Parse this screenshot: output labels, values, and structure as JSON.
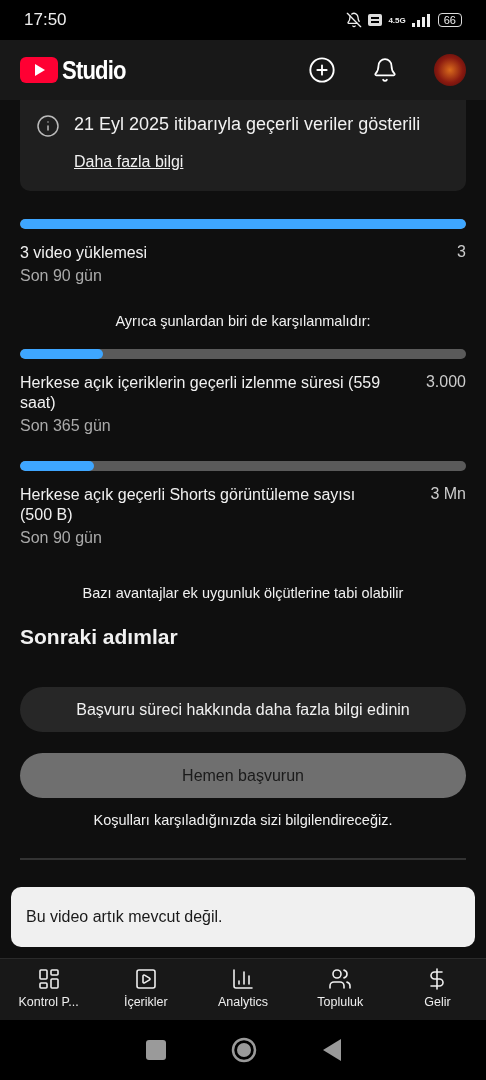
{
  "status_bar": {
    "time": "17:50",
    "network": "4.5G",
    "battery": "66"
  },
  "app_bar": {
    "logo_text": "Studio"
  },
  "info_card": {
    "message": "21 Eyl 2025 itibarıyla geçerli veriler gösterili",
    "link": "Daha fazla bilgi"
  },
  "requirements": [
    {
      "level": 1,
      "title": "3 video yüklemesi",
      "value": "3",
      "period": "Son 90 gün"
    }
  ],
  "also_note": "Ayrıca şunlardan biri de karşılanmalıdır:",
  "alternatives": [
    {
      "level": 0.186,
      "title": "Herkese açık içeriklerin geçerli izlenme süresi (559 saat)",
      "value": "3.000",
      "period": "Son 365 gün"
    },
    {
      "level": 0.167,
      "title": "Herkese açık geçerli Shorts görüntüleme sayısı (500 B)",
      "value": "3 Mn",
      "period": "Son 90 gün"
    }
  ],
  "eligibility_note": "Bazı avantajlar ek uygunluk ölçütlerine tabi olabilir",
  "next_steps": {
    "heading": "Sonraki adımlar",
    "buttons": [
      {
        "label": "Başvuru süreci hakkında daha fazla bilgi edinin",
        "disabled": false
      },
      {
        "label": "Hemen başvurun",
        "disabled": true
      }
    ],
    "notice": "Koşulları karşıladığınızda sizi bilgilendireceğiz."
  },
  "snackbar": "Bu video artık mevcut değil.",
  "bottom_nav": [
    {
      "kind": "dashboard",
      "label": "Kontrol P..."
    },
    {
      "kind": "content",
      "label": "İçerikler"
    },
    {
      "kind": "analytics",
      "label": "Analytics"
    },
    {
      "kind": "community",
      "label": "Topluluk"
    },
    {
      "kind": "earn",
      "label": "Gelir"
    }
  ]
}
